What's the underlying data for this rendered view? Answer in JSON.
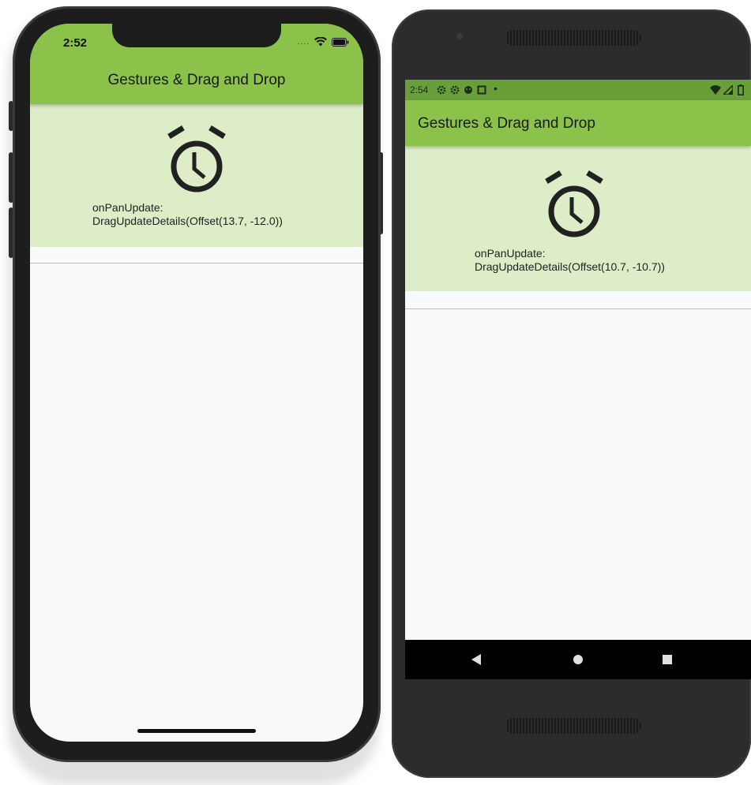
{
  "ios": {
    "time": "2:52",
    "signal": "....",
    "title": "Gestures & Drag and Drop",
    "event_name": "onPanUpdate:",
    "event_details": "DragUpdateDetails(Offset(13.7, -12.0))"
  },
  "android": {
    "time": "2:54",
    "title": "Gestures & Drag and Drop",
    "event_name": "onPanUpdate:",
    "event_details": "DragUpdateDetails(Offset(10.7, -10.7))",
    "nav": [
      "back-icon",
      "home-icon",
      "recents-icon"
    ]
  },
  "colors": {
    "appbar": "#8bc34a",
    "card": "#dcedc8",
    "status_android": "#689f38",
    "background": "#f8f9fb"
  }
}
